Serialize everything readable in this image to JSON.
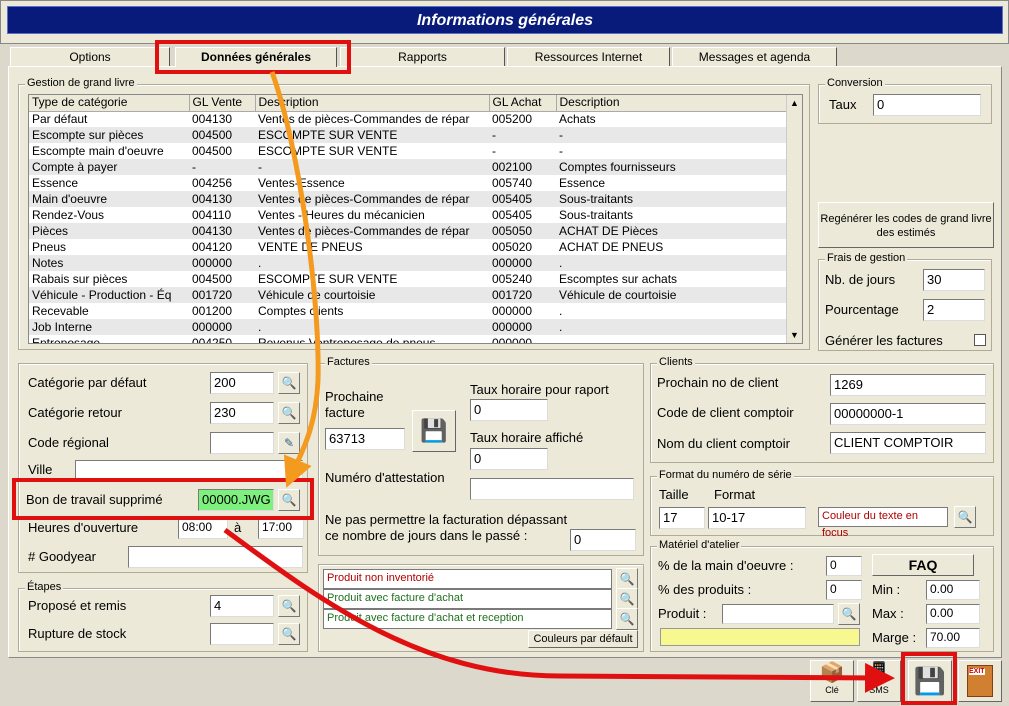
{
  "title": "Informations générales",
  "tabs": [
    "Options",
    "Données générales",
    "Rapports",
    "Ressources Internet",
    "Messages et agenda"
  ],
  "gl": {
    "group_label": "Gestion de grand livre",
    "headers": [
      "Type de catégorie",
      "GL Vente",
      "Description",
      "GL Achat",
      "Description"
    ],
    "rows": [
      [
        "Par défaut",
        "004130",
        "Ventes de pièces-Commandes de répar",
        "005200",
        "Achats"
      ],
      [
        "Escompte sur pièces",
        "004500",
        "ESCOMPTE SUR VENTE",
        "-",
        "-"
      ],
      [
        "Escompte main d'oeuvre",
        "004500",
        "ESCOMPTE SUR VENTE",
        "-",
        "-"
      ],
      [
        "Compte à payer",
        "-",
        "-",
        "002100",
        "Comptes fournisseurs"
      ],
      [
        "Essence",
        "004256",
        "Ventes-Essence",
        "005740",
        "Essence"
      ],
      [
        "Main d'oeuvre",
        "004130",
        "Ventes de pièces-Commandes de répar",
        "005405",
        "Sous-traitants"
      ],
      [
        "Rendez-Vous",
        "004110",
        "Ventes - Heures du mécanicien",
        "005405",
        "Sous-traitants"
      ],
      [
        "Pièces",
        "004130",
        "Ventes de pièces-Commandes de répar",
        "005050",
        "ACHAT DE Pièces"
      ],
      [
        "Pneus",
        "004120",
        "VENTE DE PNEUS",
        "005020",
        "ACHAT DE PNEUS"
      ],
      [
        "Notes",
        "000000",
        ".",
        "000000",
        "."
      ],
      [
        "Rabais sur pièces",
        "004500",
        "ESCOMPTE SUR VENTE",
        "005240",
        "Escomptes sur achats"
      ],
      [
        "Véhicule - Production - Éq",
        "001720",
        "Véhicule de courtoisie",
        "001720",
        "Véhicule de courtoisie"
      ],
      [
        "Recevable",
        "001200",
        "Comptes clients",
        "000000",
        "."
      ],
      [
        "Job Interne",
        "000000",
        ".",
        "000000",
        "."
      ],
      [
        "Entreposage",
        "004250",
        "Revenus Ventreposage de pneus",
        "000000",
        "."
      ]
    ]
  },
  "conversion": {
    "label": "Conversion",
    "taux_label": "Taux",
    "taux": "0"
  },
  "regen_button": "Regénérer les codes de grand livre des estimés",
  "frais": {
    "label": "Frais de gestion",
    "jours_label": "Nb. de jours",
    "jours": "30",
    "pct_label": "Pourcentage",
    "pct": "2",
    "gen_label": "Générer les factures"
  },
  "left": {
    "cat_defaut_label": "Catégorie par défaut",
    "cat_defaut": "200",
    "cat_retour_label": "Catégorie retour",
    "cat_retour": "230",
    "code_reg_label": "Code régional",
    "code_reg": "",
    "ville_label": "Ville",
    "ville": "",
    "bon_label": "Bon de travail supprimé",
    "bon": "00000.JWG",
    "heures_label": "Heures d'ouverture",
    "heure_de": "08:00",
    "a_label": "à",
    "heure_a": "17:00",
    "goodyear_label": "# Goodyear",
    "goodyear": ""
  },
  "etapes": {
    "label": "Étapes",
    "propose_label": "Proposé et remis",
    "propose": "4",
    "rupture_label": "Rupture de stock",
    "rupture": ""
  },
  "factures": {
    "label": "Factures",
    "prochaine_label": "Prochaine facture",
    "prochaine": "63713",
    "taux_rapport_label": "Taux horaire pour raport",
    "taux_rapport": "0",
    "taux_affiche_label": "Taux horaire affiché",
    "taux_affiche": "0",
    "attestation_label": "Numéro d'attestation",
    "attestation": "",
    "jours_label": "Ne pas permettre la facturation dépassant ce nombre de jours dans le passé :",
    "jours": "0"
  },
  "colors": {
    "items": [
      "Produit non inventorié",
      "Produit avec facture d'achat",
      "Produit avec facture d'achat et reception"
    ],
    "item_colors": [
      "#b00000",
      "#207020",
      "#207020"
    ],
    "default_button": "Couleurs par défault"
  },
  "clients": {
    "label": "Clients",
    "next_label": "Prochain no de client",
    "next": "1269",
    "code_label": "Code de client comptoir",
    "code": "00000000-1",
    "nom_label": "Nom du client comptoir",
    "nom": "CLIENT COMPTOIR"
  },
  "serie": {
    "label": "Format du numéro de série",
    "taille_label": "Taille",
    "format_label": "Format",
    "taille": "17",
    "format": "10-17",
    "focus_text": "Couleur du texte en focus"
  },
  "atelier": {
    "label": "Matériel d'atelier",
    "mo_label": "% de la main d'oeuvre :",
    "mo": "0",
    "prod_label": "% des produits :",
    "prod": "0",
    "produit_label": "Produit :",
    "produit": "",
    "faq": "FAQ",
    "min_label": "Min :",
    "min": "0.00",
    "max_label": "Max :",
    "max": "0.00",
    "marge_label": "Marge :",
    "marge": "70.00"
  },
  "bottom": {
    "cle_label": "Clé",
    "sms_label": "SMS",
    "exit_label": "EXIT"
  }
}
